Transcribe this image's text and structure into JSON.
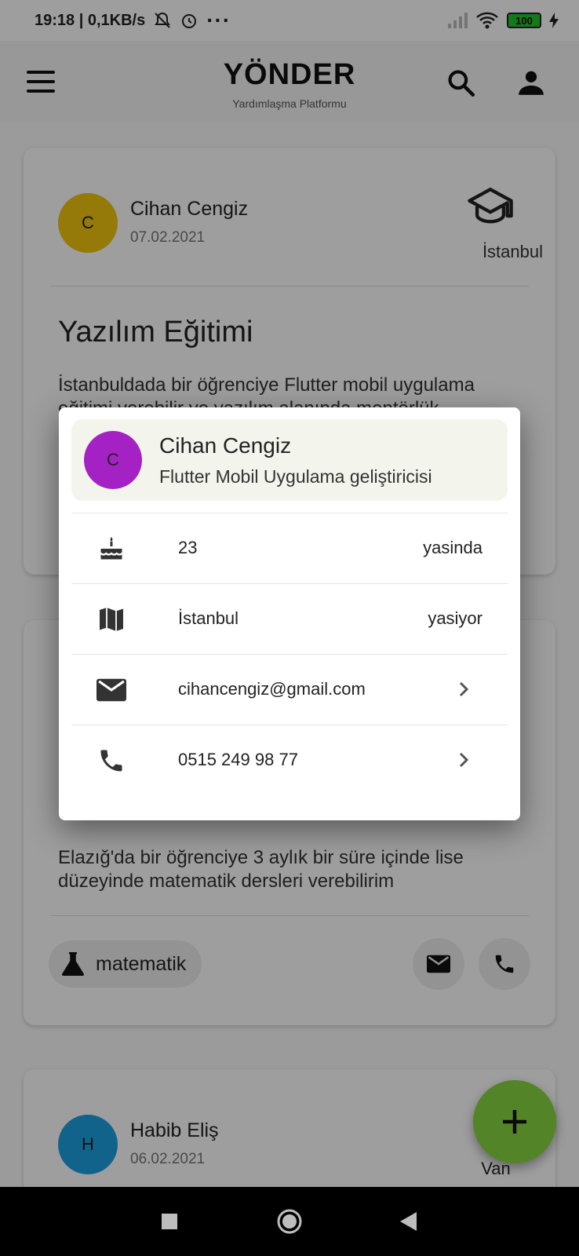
{
  "status_bar": {
    "time_speed": "19:18 | 0,1KB/s",
    "dots": "···",
    "battery": "100"
  },
  "app_bar": {
    "title": "YÖNDER",
    "subtitle": "Yardımlaşma Platformu"
  },
  "posts": [
    {
      "avatar_letter": "C",
      "avatar_color": "#f1c40f",
      "name": "Cihan Cengiz",
      "date": "07.02.2021",
      "category_icon": "school-icon",
      "city": "İstanbul",
      "title": "Yazılım Eğitimi",
      "description": "İstanbuldada bir öğrenciye Flutter mobil uygulama eğitimi verebilir ve yazılım alanında mentörlük"
    },
    {
      "description": "Elazığ'da bir öğrenciye 3 aylık bir süre içinde lise düzeyinde matematik dersleri verebilirim",
      "tag_icon": "flask-icon",
      "tag": "matematik"
    },
    {
      "avatar_letter": "H",
      "avatar_color": "#1ea0e0",
      "name": "Habib Eliş",
      "date": "06.02.2021",
      "city": "Van"
    }
  ],
  "dialog": {
    "avatar_letter": "C",
    "avatar_color": "#a422c4",
    "name": "Cihan Cengiz",
    "role": "Flutter Mobil Uygulama geliştiricisi",
    "rows": [
      {
        "icon": "cake-icon",
        "value": "23",
        "trailing": "yasinda"
      },
      {
        "icon": "map-icon",
        "value": "İstanbul",
        "trailing": "yasiyor"
      },
      {
        "icon": "mail-icon",
        "value": "cihancengiz@gmail.com",
        "trailing_icon": "chevron-right-icon"
      },
      {
        "icon": "phone-icon",
        "value": "0515 249 98 77",
        "trailing_icon": "chevron-right-icon"
      }
    ]
  },
  "fab": {
    "icon": "plus-icon",
    "color": "#86d63f"
  },
  "nav_bar": {
    "icons": [
      "recents-icon",
      "home-icon",
      "back-icon"
    ]
  }
}
